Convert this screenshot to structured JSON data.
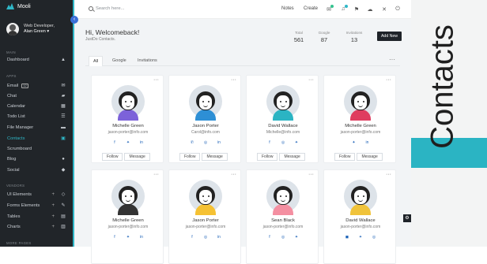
{
  "app": {
    "brand": "Mooli",
    "user_role": "Web Developer,",
    "user_name": "Alan Green ▾"
  },
  "sidebar": {
    "sections": [
      {
        "label": "MAIN"
      },
      {
        "label": "APPS"
      },
      {
        "label": "VENDORS"
      },
      {
        "label": "MORE PAGES"
      }
    ],
    "items": [
      {
        "label": "Dashboard",
        "icon": "dashboard-icon"
      },
      {
        "label": "Email",
        "icon": "envelope-icon",
        "badge": "12"
      },
      {
        "label": "Chat",
        "icon": "chat-icon"
      },
      {
        "label": "Calendar",
        "icon": "calendar-icon"
      },
      {
        "label": "Todo List",
        "icon": "list-icon"
      },
      {
        "label": "File Manager",
        "icon": "folder-icon"
      },
      {
        "label": "Contacts",
        "icon": "contacts-icon",
        "active": true
      },
      {
        "label": "Scrumboard",
        "icon": "board-icon"
      },
      {
        "label": "Blog",
        "icon": "globe-icon"
      },
      {
        "label": "Social",
        "icon": "share-icon"
      },
      {
        "label": "UI Elements",
        "icon": "diamond-icon"
      },
      {
        "label": "Forms Elements",
        "icon": "pencil-icon"
      },
      {
        "label": "Tables",
        "icon": "table-icon"
      },
      {
        "label": "Charts",
        "icon": "chart-icon"
      }
    ]
  },
  "topbar": {
    "search_placeholder": "Search here...",
    "links": [
      "Notes",
      "Create"
    ]
  },
  "header": {
    "greeting": "Hi, Welcomeback!",
    "subtitle": "JustDo Contacts.",
    "stats": [
      {
        "label": "Total",
        "value": "561"
      },
      {
        "label": "Google",
        "value": "87"
      },
      {
        "label": "Invitations",
        "value": "13"
      }
    ],
    "add_button": "Add New"
  },
  "tabs": [
    "All",
    "Google",
    "Invitations"
  ],
  "card_buttons": {
    "follow": "Follow",
    "message": "Message"
  },
  "contacts": [
    {
      "name": "Michelle Green",
      "email": "jason-porter@info.com",
      "shirt": "#7c62d9"
    },
    {
      "name": "Jason Porter",
      "email": "Carol@info.com",
      "shirt": "#2d8fd5"
    },
    {
      "name": "David Wallace",
      "email": "Michelle@info.com",
      "shirt": "#2bb4c3"
    },
    {
      "name": "Michelle Green",
      "email": "jason-porter@info.com",
      "shirt": "#df3c5f"
    },
    {
      "name": "Michelle Green",
      "email": "jason-porter@info.com",
      "shirt": "#333333"
    },
    {
      "name": "Jason Porter",
      "email": "jason-porter@info.com",
      "shirt": "#f5c133"
    },
    {
      "name": "Sean Black",
      "email": "jason-porter@info.com",
      "shirt": "#f48fa1"
    },
    {
      "name": "David Wallace",
      "email": "jason-porter@info.com",
      "shirt": "#f0c33a"
    }
  ],
  "promo": {
    "text": "Contacts"
  }
}
